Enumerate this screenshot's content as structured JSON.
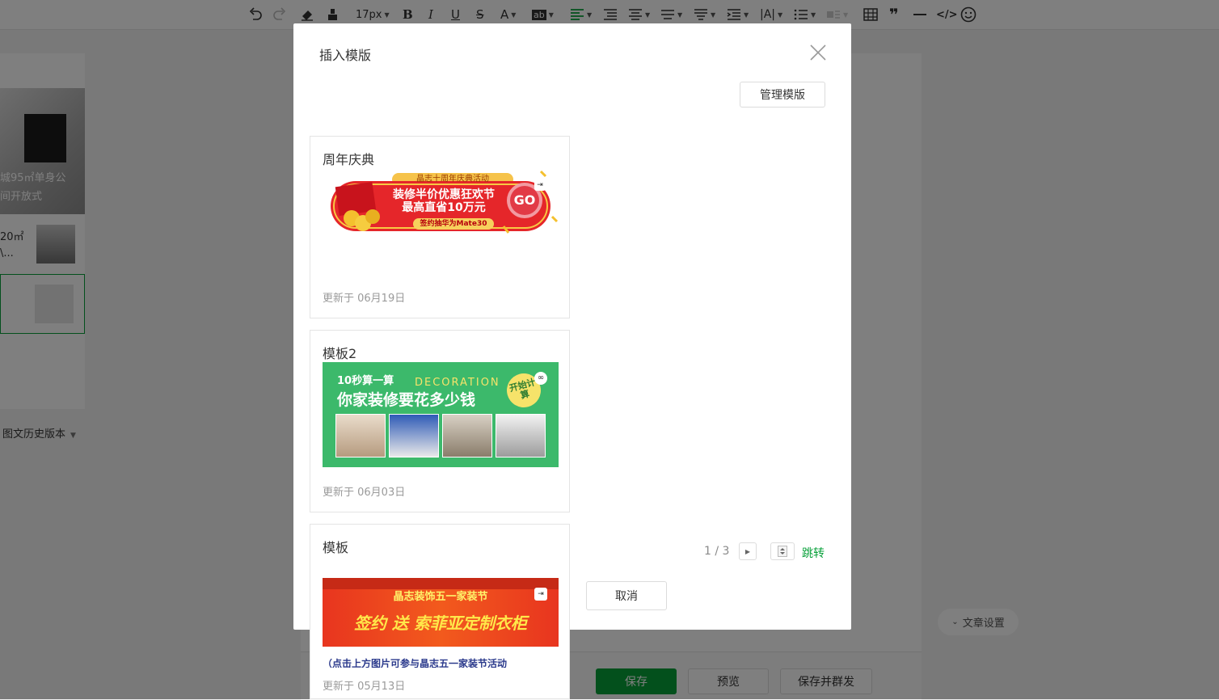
{
  "toolbar": {
    "font_size": "17px"
  },
  "background": {
    "article1_line1": "城95㎡单身公",
    "article1_line2": "间开放式",
    "article2_line1": "20㎡",
    "article2_line2": "\\...",
    "history_label": "图文历史版本",
    "article_settings": "文章设置",
    "save": "保存",
    "preview": "预览",
    "save_and_send": "保存并群发"
  },
  "dialog": {
    "title": "插入模版",
    "manage_button": "管理模版",
    "cancel_button": "取消",
    "templates": [
      {
        "name": "周年庆典",
        "updated": "更新于 06月19日",
        "banner": {
          "top_text": "晶志十周年庆典活动",
          "line1": "装修半价优惠狂欢节",
          "line2": "最高直省10万元",
          "pill": "签约抽华为Mate30",
          "go": "GO"
        }
      },
      {
        "name": "模板2",
        "updated": "更新于 06月03日",
        "banner": {
          "small": "10秒算一算",
          "deco": "DECORATION",
          "big": "你家装修要花多少钱",
          "badge": "开始计算"
        }
      },
      {
        "name": "模板",
        "updated": "更新于 05月13日",
        "banner": {
          "top": "晶志装饰五一家装节",
          "big": "签约 送 索菲亚定制衣柜",
          "caption": "（点击上方图片可参与晶志五一家装节活动"
        }
      }
    ],
    "pagination": {
      "text": "1 / 3",
      "jump": "跳转"
    }
  },
  "colors": {
    "accent": "#07c160",
    "save_button": "#07a039"
  }
}
